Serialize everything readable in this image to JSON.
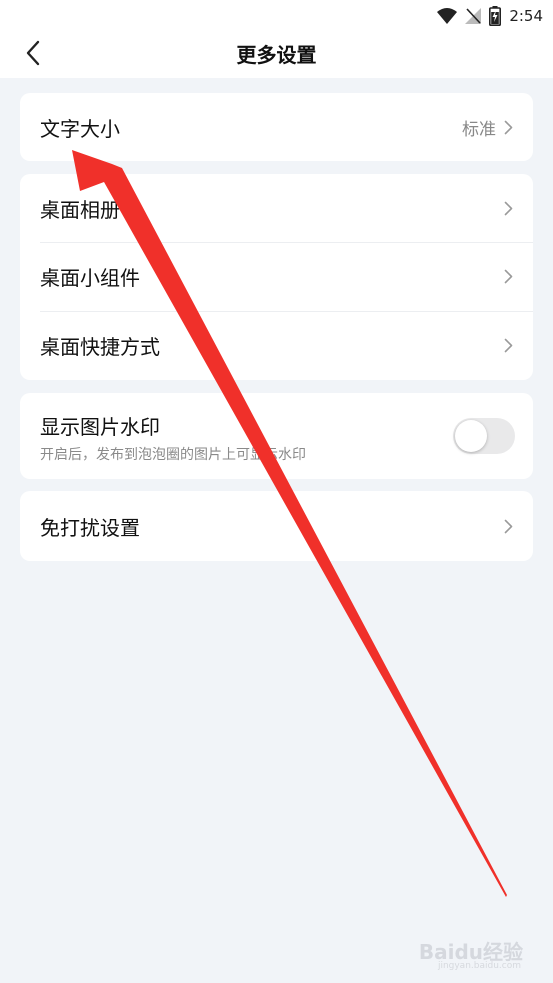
{
  "status_bar": {
    "time": "2:54"
  },
  "header": {
    "title": "更多设置"
  },
  "font_size_card": {
    "label": "文字大小",
    "value": "标准"
  },
  "desktop_card": {
    "items": [
      {
        "label": "桌面相册"
      },
      {
        "label": "桌面小组件"
      },
      {
        "label": "桌面快捷方式"
      }
    ]
  },
  "watermark_card": {
    "title": "显示图片水印",
    "subtitle": "开启后，发布到泡泡圈的图片上可显示水印",
    "enabled": false
  },
  "dnd_card": {
    "label": "免打扰设置"
  },
  "overlay": {
    "arrow_color": "#f0302a"
  },
  "watermark": {
    "text": "Baidu经验",
    "url": "jingyan.baidu.com"
  }
}
